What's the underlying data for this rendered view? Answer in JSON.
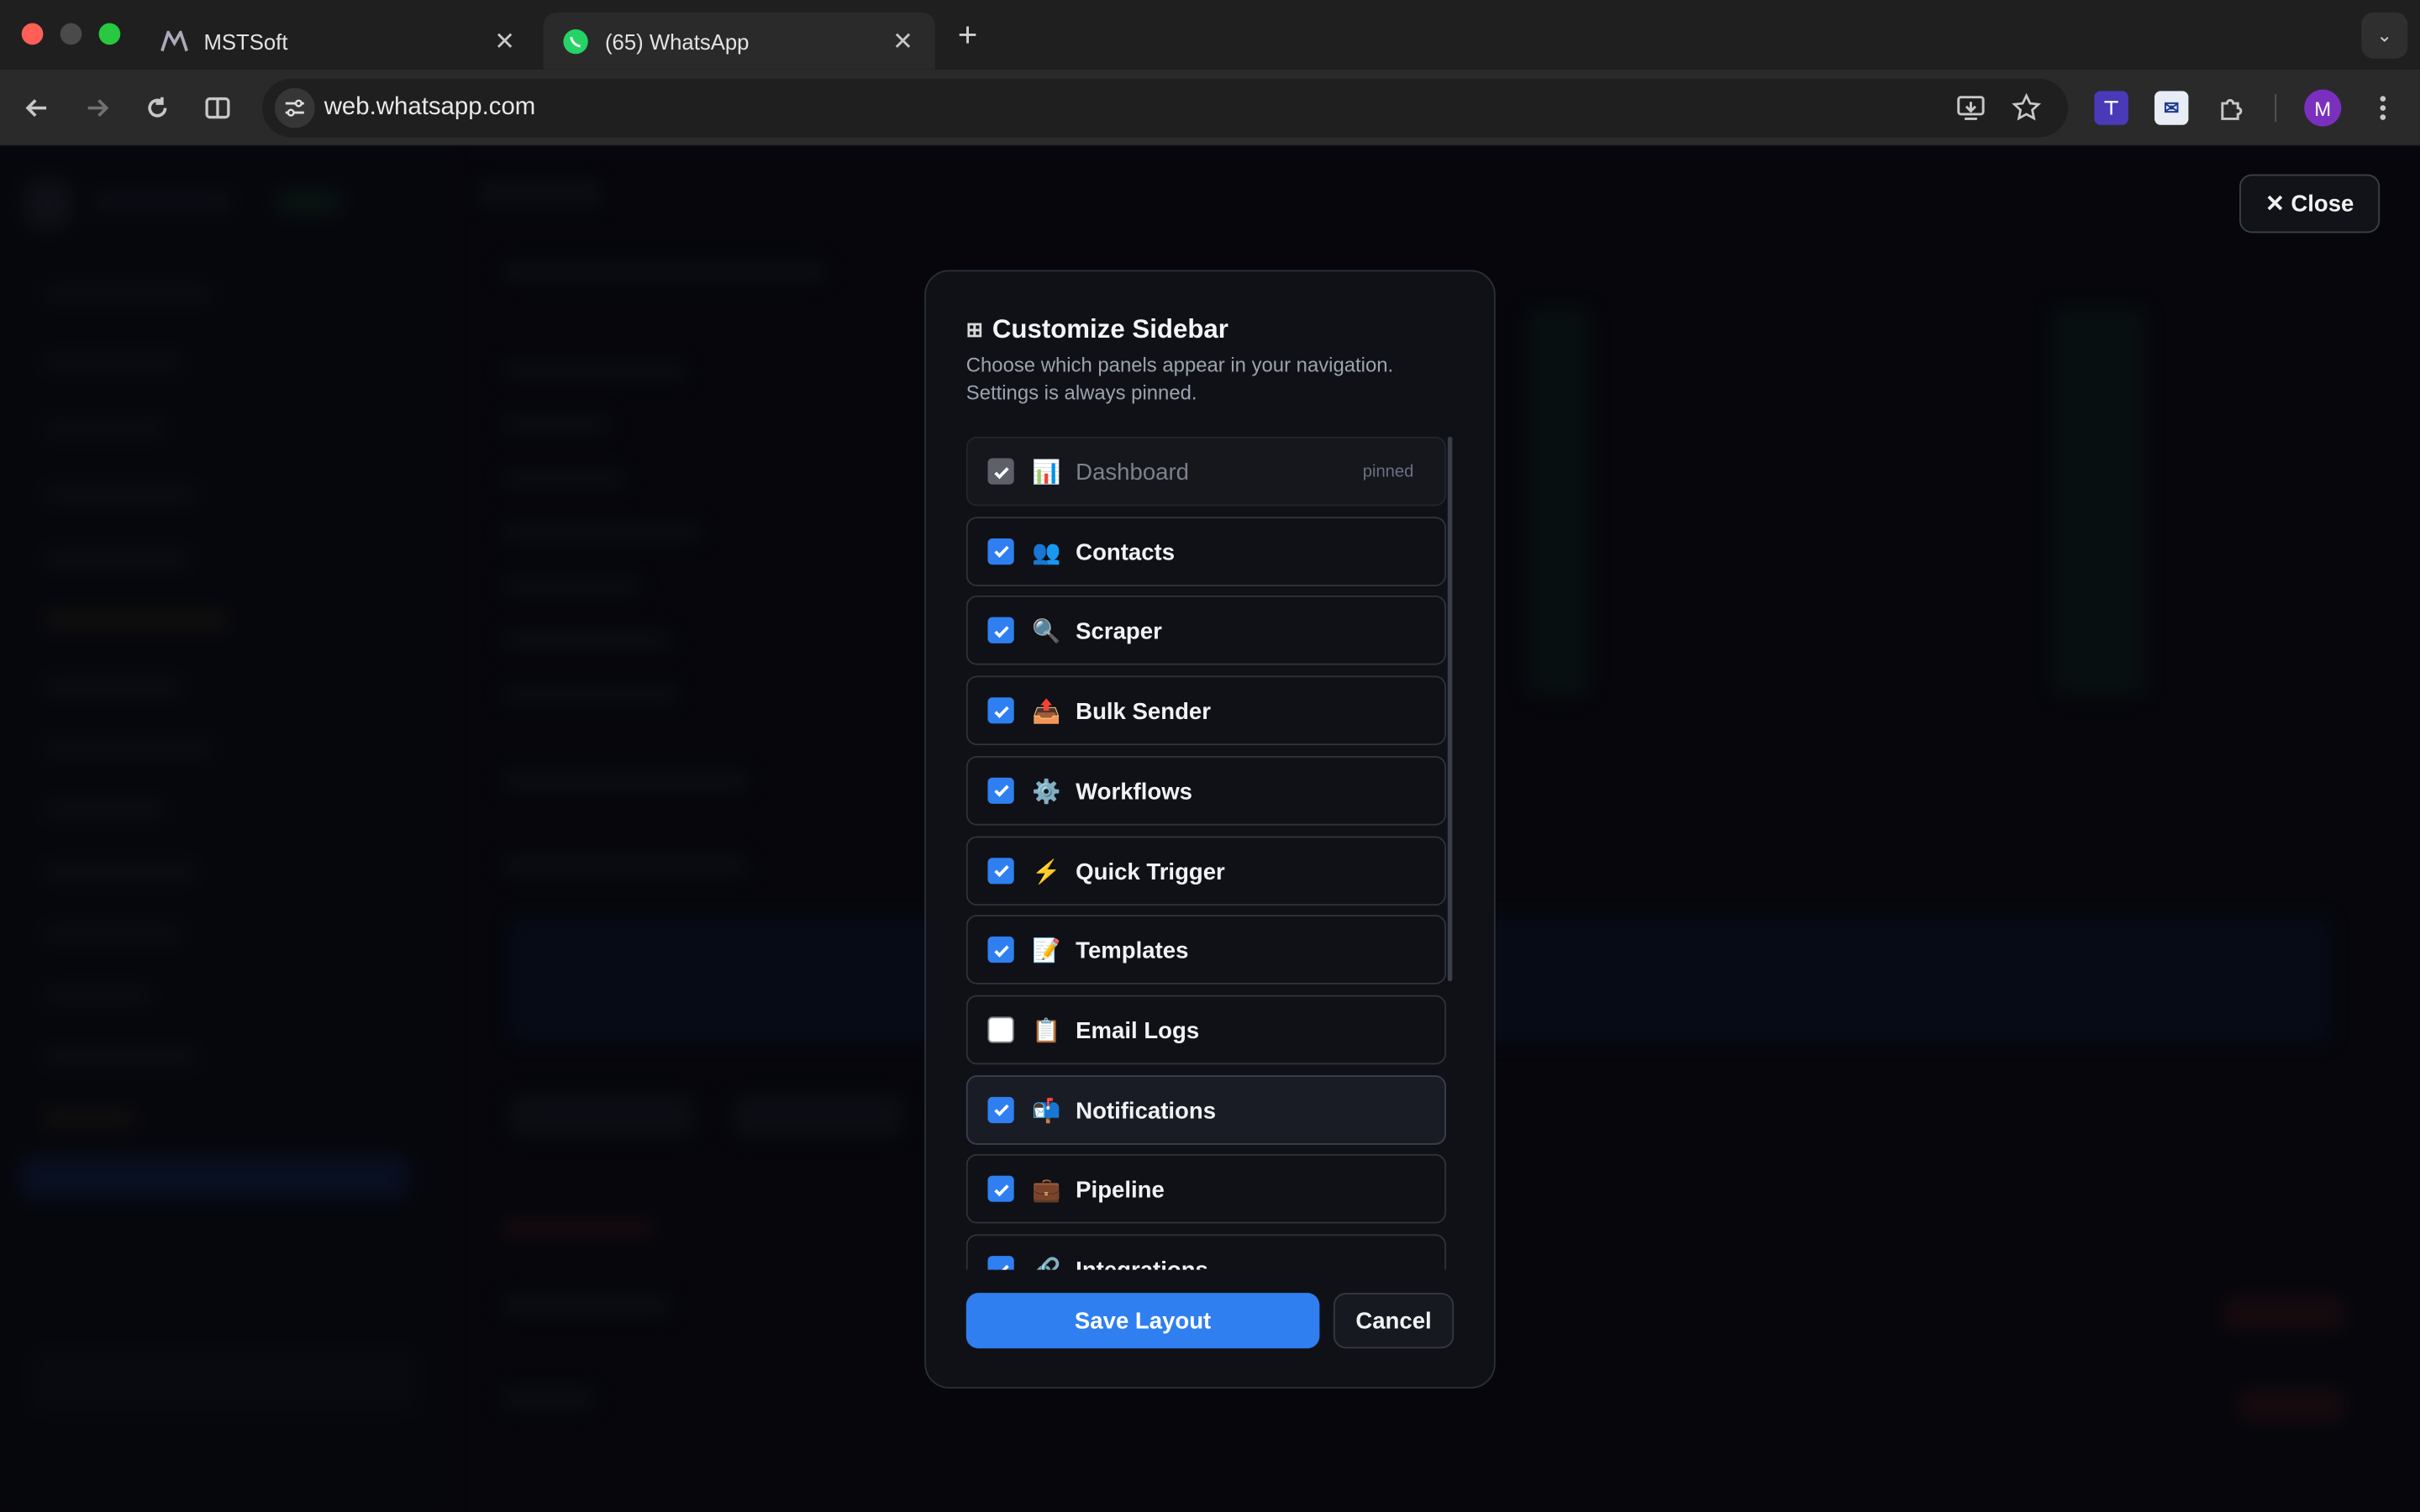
{
  "browser": {
    "tabs": [
      {
        "title": "MSTSoft",
        "favicon": "mstsoft-logo-icon",
        "active": false
      },
      {
        "title": "(65) WhatsApp",
        "favicon": "whatsapp-icon",
        "active": true
      }
    ],
    "url": "web.whatsapp.com",
    "profile_initial": "M"
  },
  "overlay": {
    "close_label": "Close"
  },
  "modal": {
    "title": "Customize Sidebar",
    "description": "Choose which panels appear in your navigation. Settings is always pinned.",
    "items": [
      {
        "label": "Dashboard",
        "icon": "📊",
        "checked": true,
        "pinned": true,
        "badge": "pinned"
      },
      {
        "label": "Contacts",
        "icon": "👥",
        "checked": true
      },
      {
        "label": "Scraper",
        "icon": "🔍",
        "checked": true
      },
      {
        "label": "Bulk Sender",
        "icon": "📤",
        "checked": true
      },
      {
        "label": "Workflows",
        "icon": "⚙️",
        "checked": true
      },
      {
        "label": "Quick Trigger",
        "icon": "⚡",
        "checked": true
      },
      {
        "label": "Templates",
        "icon": "📝",
        "checked": true
      },
      {
        "label": "Email Logs",
        "icon": "📋",
        "checked": false
      },
      {
        "label": "Notifications",
        "icon": "📬",
        "checked": true
      },
      {
        "label": "Pipeline",
        "icon": "💼",
        "checked": true
      },
      {
        "label": "Integrations",
        "icon": "🔗",
        "checked": true
      }
    ],
    "save_label": "Save Layout",
    "cancel_label": "Cancel"
  },
  "colors": {
    "accent": "#2f7ff0",
    "modal_bg": "#0f1117",
    "whatsapp_green": "#25d366"
  }
}
